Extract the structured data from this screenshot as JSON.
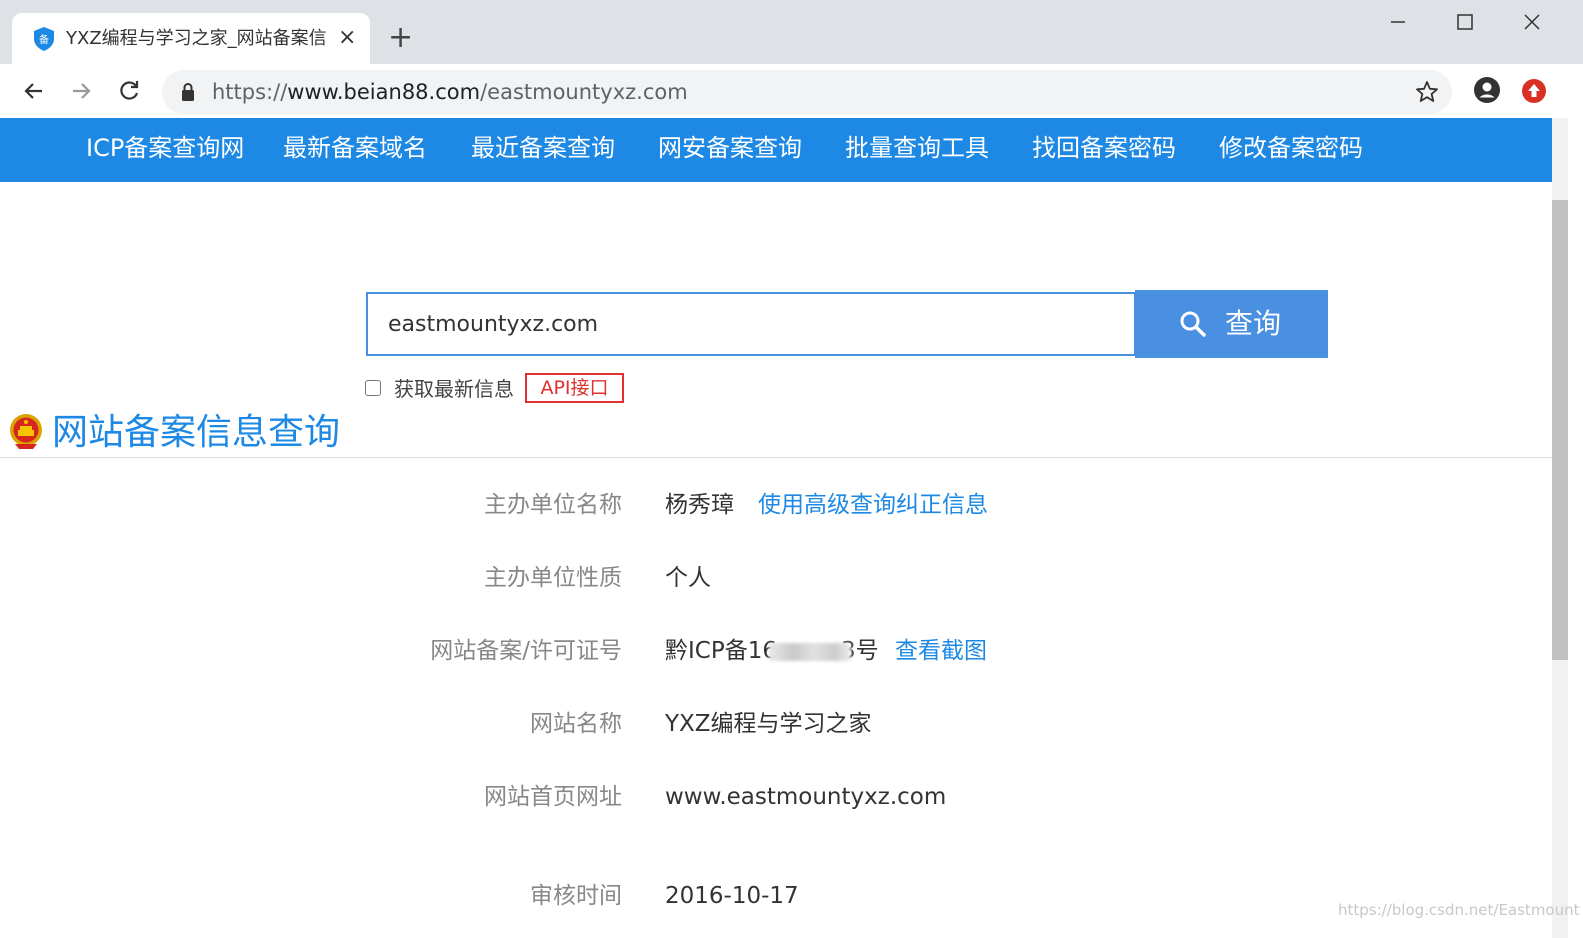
{
  "browser": {
    "tab_title": "YXZ编程与学习之家_网站备案信息",
    "tab_close": "×",
    "new_tab": "+",
    "url_scheme": "https://",
    "url_host": "www.beian88.com",
    "url_path": "/eastmountyxz.com"
  },
  "nav": {
    "items": [
      "ICP备案查询网",
      "最新备案域名",
      "最近备案查询",
      "网安备案查询",
      "批量查询工具",
      "找回备案密码",
      "修改备案密码"
    ]
  },
  "search": {
    "value": "eastmountyxz.com",
    "button_label": "查询",
    "checkbox_label": "获取最新信息",
    "api_label": "API接口"
  },
  "section_title": "网站备案信息查询",
  "info": {
    "sponsor_label": "主办单位名称",
    "sponsor_value": "杨秀璋",
    "sponsor_link": "使用高级查询纠正信息",
    "nature_label": "主办单位性质",
    "nature_value": "个人",
    "license_label": "网站备案/许可证号",
    "license_prefix": "黔ICP备16",
    "license_suffix": "3号",
    "license_link": "查看截图",
    "site_name_label": "网站名称",
    "site_name_value": "YXZ编程与学习之家",
    "homepage_label": "网站首页网址",
    "homepage_value": "www.eastmountyxz.com",
    "review_label": "审核时间",
    "review_value": "2016-10-17"
  },
  "watermark": "https://blog.csdn.net/Eastmount",
  "colors": {
    "nav_bg": "#1e88e5",
    "button_bg": "#4a90e2",
    "link": "#1e88e5",
    "api": "#e03131"
  }
}
